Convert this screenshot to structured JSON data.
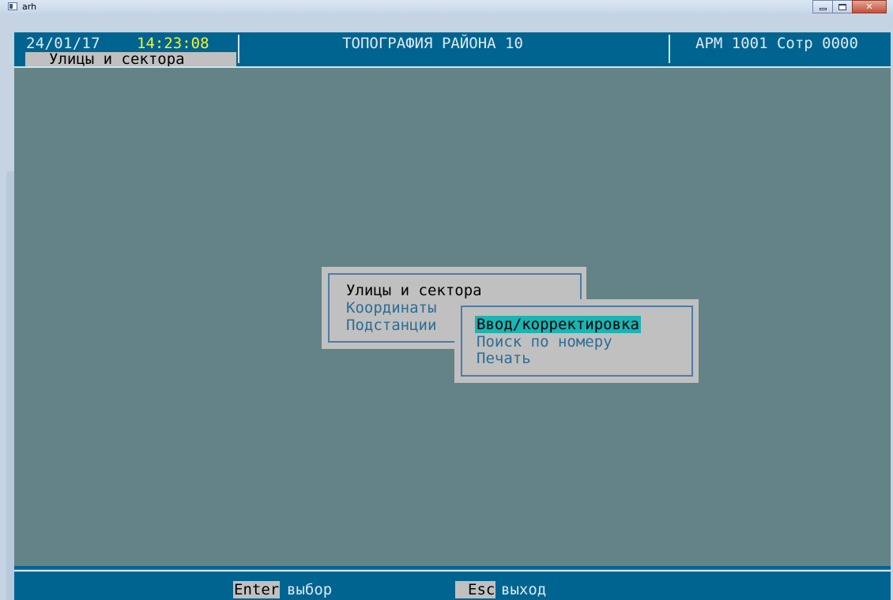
{
  "window": {
    "title": "arh"
  },
  "header": {
    "date": "24/01/17",
    "time": "14:23:08",
    "title": "ТОПОГРАФИЯ РАЙОНА 10",
    "workstation": "АРМ 1001 Сотр 0000",
    "active_tab": "Улицы и сектора"
  },
  "main_menu": {
    "items": [
      {
        "label": "Улицы и сектора",
        "active": true
      },
      {
        "label": "Координаты",
        "active": false
      },
      {
        "label": "Подстанции",
        "active": false
      }
    ]
  },
  "sub_menu": {
    "items": [
      {
        "label": "Ввод/корректировка",
        "selected": true
      },
      {
        "label": "Поиск по номеру",
        "selected": false
      },
      {
        "label": "Печать",
        "selected": false
      }
    ]
  },
  "footer": {
    "keys": [
      {
        "key": "Enter",
        "action": "выбор"
      },
      {
        "key": "Esc",
        "action": "выход"
      }
    ]
  },
  "colors": {
    "background": "#638386",
    "bar": "#006491",
    "menu_bg": "#c0c0c0",
    "menu_frame": "#4b7da8",
    "active_text": "#000000",
    "inactive_text": "#2b6d97",
    "selection": "#1ab4b4",
    "time_text": "#f2f234"
  },
  "icons": {
    "app": "console-window-icon",
    "minimize": "minimize-icon",
    "maximize": "maximize-icon",
    "close": "close-icon"
  }
}
